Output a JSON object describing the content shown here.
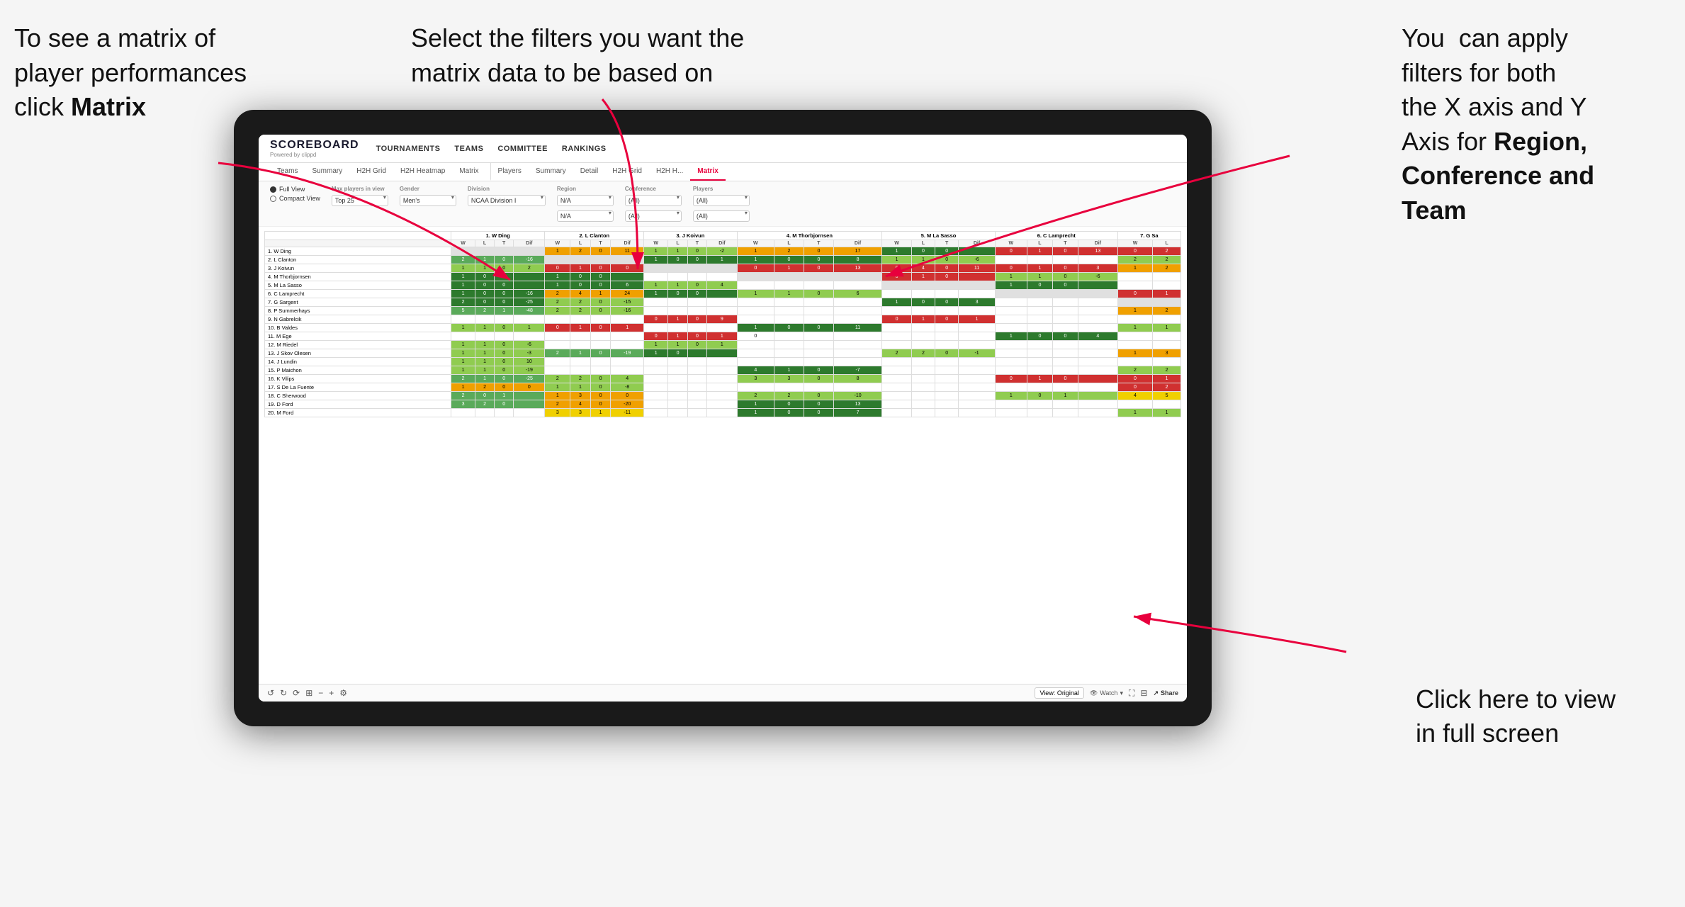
{
  "annotations": {
    "topleft": {
      "line1": "To see a matrix of",
      "line2": "player performances",
      "line3_prefix": "click ",
      "line3_bold": "Matrix"
    },
    "topmid": {
      "text": "Select the filters you want the matrix data to be based on"
    },
    "topright": {
      "line1": "You  can apply",
      "line2": "filters for both",
      "line3": "the X axis and Y",
      "line4_prefix": "Axis for ",
      "line4_bold": "Region,",
      "line5_bold": "Conference and",
      "line6_bold": "Team"
    },
    "bottomright": {
      "line1": "Click here to view",
      "line2": "in full screen"
    }
  },
  "app": {
    "logo_main": "SCOREBOARD",
    "logo_sub": "Powered by clippd",
    "nav": [
      "TOURNAMENTS",
      "TEAMS",
      "COMMITTEE",
      "RANKINGS"
    ],
    "tabs_row1": [
      "Teams",
      "Summary",
      "H2H Grid",
      "H2H Heatmap",
      "Matrix",
      "Players",
      "Summary",
      "Detail",
      "H2H Grid",
      "H2H H...",
      "Matrix"
    ],
    "active_tab": "Matrix",
    "filters": {
      "view_options": [
        "Full View",
        "Compact View"
      ],
      "selected_view": "Full View",
      "max_players_label": "Max players in view",
      "max_players_value": "Top 25",
      "gender_label": "Gender",
      "gender_value": "Men's",
      "division_label": "Division",
      "division_value": "NCAA Division I",
      "region_label": "Region",
      "region_value": "N/A",
      "conference_label": "Conference",
      "conference_value1": "(All)",
      "conference_value2": "(All)",
      "players_label": "Players",
      "players_value1": "(All)",
      "players_value2": "(All)"
    },
    "column_headers": [
      "1. W Ding",
      "2. L Clanton",
      "3. J Koivun",
      "4. M Thorbjornsen",
      "5. M La Sasso",
      "6. C Lamprecht",
      "7. G Sa"
    ],
    "sub_headers": [
      "W",
      "L",
      "T",
      "Dif"
    ],
    "rows": [
      {
        "name": "1. W Ding",
        "cells": [
          [
            null,
            null,
            null,
            null
          ],
          [
            1,
            2,
            0,
            11
          ],
          [
            1,
            1,
            0,
            -2
          ],
          [
            1,
            2,
            0,
            17
          ],
          [
            1,
            0,
            0,
            null
          ],
          [
            0,
            1,
            0,
            13
          ],
          [
            0,
            2
          ]
        ]
      },
      {
        "name": "2. L Clanton",
        "cells": [
          [
            2,
            1,
            0,
            -16
          ],
          [
            null,
            null,
            null,
            null
          ],
          [
            1,
            0,
            0,
            1
          ],
          [
            1,
            0,
            0,
            8
          ],
          [
            1,
            1,
            0,
            -6
          ],
          [
            null,
            null,
            null,
            null
          ],
          [
            2,
            2
          ]
        ]
      },
      {
        "name": "3. J Koivun",
        "cells": [
          [
            1,
            1,
            0,
            2
          ],
          [
            0,
            1,
            0,
            0
          ],
          [
            null,
            null,
            null,
            null
          ],
          [
            0,
            1,
            0,
            13
          ],
          [
            0,
            4,
            0,
            11
          ],
          [
            0,
            1,
            0,
            3
          ],
          [
            1,
            2
          ]
        ]
      },
      {
        "name": "4. M Thorbjornsen",
        "cells": [
          [
            1,
            0,
            0,
            null
          ],
          [
            1,
            0,
            0,
            null
          ],
          [
            null,
            null,
            null,
            null
          ],
          [
            null,
            null,
            null,
            null
          ],
          [
            0,
            1,
            0,
            null
          ],
          [
            1,
            1,
            0,
            -6
          ],
          [
            null
          ]
        ]
      },
      {
        "name": "5. M La Sasso",
        "cells": [
          [
            1,
            0,
            0,
            null
          ],
          [
            1,
            0,
            0,
            6
          ],
          [
            1,
            1,
            0,
            4
          ],
          [
            null,
            null,
            null,
            null
          ],
          [
            null,
            null,
            null,
            null
          ],
          [
            1,
            0,
            0,
            null
          ],
          [
            null
          ]
        ]
      },
      {
        "name": "6. C Lamprecht",
        "cells": [
          [
            1,
            0,
            0,
            -16
          ],
          [
            2,
            4,
            1,
            24
          ],
          [
            1,
            0,
            0,
            null
          ],
          [
            1,
            1,
            0,
            6
          ],
          [
            null,
            null,
            null,
            null
          ],
          [
            null,
            null,
            null,
            null
          ],
          [
            0,
            1
          ]
        ]
      },
      {
        "name": "7. G Sargent",
        "cells": [
          [
            2,
            0,
            0,
            -25
          ],
          [
            2,
            2,
            0,
            -15
          ],
          [
            null,
            null,
            null,
            null
          ],
          [
            null,
            null,
            null,
            null
          ],
          [
            1,
            0,
            0,
            3
          ],
          [
            null,
            null,
            null,
            null
          ],
          [
            null
          ]
        ]
      },
      {
        "name": "8. P Summerhays",
        "cells": [
          [
            5,
            2,
            1,
            -48
          ],
          [
            2,
            2,
            0,
            -16
          ],
          [
            null,
            null,
            null,
            null
          ],
          [
            null,
            null,
            null,
            null
          ],
          [
            null,
            null,
            null,
            null
          ],
          [
            null,
            null,
            null,
            null
          ],
          [
            1,
            2
          ]
        ]
      },
      {
        "name": "9. N Gabrelcik",
        "cells": [
          [
            null,
            null,
            null,
            null
          ],
          [
            null,
            null,
            null,
            null
          ],
          [
            0,
            1,
            0,
            9
          ],
          [
            null,
            null,
            null,
            null
          ],
          [
            0,
            1,
            0,
            1
          ],
          [
            null,
            null,
            null,
            null
          ],
          [
            null
          ]
        ]
      },
      {
        "name": "10. B Valdes",
        "cells": [
          [
            1,
            1,
            0,
            1
          ],
          [
            0,
            1,
            0,
            1
          ],
          [
            null,
            null,
            null,
            null
          ],
          [
            1,
            0,
            0,
            11
          ],
          [
            null,
            null,
            null,
            null
          ],
          [
            null,
            null,
            null,
            null
          ],
          [
            1,
            1
          ]
        ]
      },
      {
        "name": "11. M Ege",
        "cells": [
          [
            null,
            null,
            null,
            null
          ],
          [
            null,
            null,
            null,
            null
          ],
          [
            0,
            1,
            0,
            1
          ],
          [
            0,
            null,
            null,
            null
          ],
          [
            null,
            null,
            null,
            null
          ],
          [
            1,
            0,
            0,
            4
          ],
          [
            null
          ]
        ]
      },
      {
        "name": "12. M Riedel",
        "cells": [
          [
            1,
            1,
            0,
            -6
          ],
          [
            null,
            null,
            null,
            null
          ],
          [
            1,
            1,
            0,
            1
          ],
          [
            null,
            null,
            null,
            null
          ],
          [
            null,
            null,
            null,
            null
          ],
          [
            null,
            null,
            null,
            null
          ],
          [
            null
          ]
        ]
      },
      {
        "name": "13. J Skov Olesen",
        "cells": [
          [
            1,
            1,
            0,
            -3
          ],
          [
            2,
            1,
            0,
            -19
          ],
          [
            1,
            0,
            null,
            null
          ],
          [
            null,
            null,
            null,
            null
          ],
          [
            2,
            2,
            0,
            -1
          ],
          [
            null,
            null,
            null,
            null
          ],
          [
            1,
            3
          ]
        ]
      },
      {
        "name": "14. J Lundin",
        "cells": [
          [
            1,
            1,
            0,
            10
          ],
          [
            null,
            null,
            null,
            null
          ],
          [
            null,
            null,
            null,
            null
          ],
          [
            null,
            null,
            null,
            null
          ],
          [
            null,
            null,
            null,
            null
          ],
          [
            null,
            null,
            null,
            null
          ],
          [
            null
          ]
        ]
      },
      {
        "name": "15. P Maichon",
        "cells": [
          [
            1,
            1,
            0,
            -19
          ],
          [
            null,
            null,
            null,
            null
          ],
          [
            null,
            null,
            null,
            null
          ],
          [
            4,
            1,
            0,
            -7
          ],
          [
            null,
            null,
            null,
            null
          ],
          [
            null,
            null,
            null,
            null
          ],
          [
            2,
            2
          ]
        ]
      },
      {
        "name": "16. K Vilips",
        "cells": [
          [
            2,
            1,
            0,
            -25
          ],
          [
            2,
            2,
            0,
            4
          ],
          [
            null,
            null,
            null,
            null
          ],
          [
            3,
            3,
            0,
            8
          ],
          [
            null,
            null,
            null,
            null
          ],
          [
            0,
            1,
            0,
            null
          ],
          [
            0,
            1
          ]
        ]
      },
      {
        "name": "17. S De La Fuente",
        "cells": [
          [
            1,
            2,
            0,
            0
          ],
          [
            1,
            1,
            0,
            -8
          ],
          [
            null,
            null,
            null,
            null
          ],
          [
            null,
            null,
            null,
            null
          ],
          [
            null,
            null,
            null,
            null
          ],
          [
            null,
            null,
            null,
            null
          ],
          [
            0,
            2
          ]
        ]
      },
      {
        "name": "18. C Sherwood",
        "cells": [
          [
            2,
            0,
            1,
            null
          ],
          [
            1,
            3,
            0,
            0
          ],
          [
            null,
            null,
            null,
            null
          ],
          [
            2,
            2,
            0,
            -10
          ],
          [
            null,
            null,
            null,
            null
          ],
          [
            1,
            0,
            1,
            null
          ],
          [
            4,
            5
          ]
        ]
      },
      {
        "name": "19. D Ford",
        "cells": [
          [
            3,
            2,
            0,
            null
          ],
          [
            2,
            4,
            0,
            -20
          ],
          [
            null,
            null,
            null,
            null
          ],
          [
            1,
            0,
            0,
            13
          ],
          [
            null,
            null,
            null,
            null
          ],
          [
            null,
            null,
            null,
            null
          ],
          [
            null
          ]
        ]
      },
      {
        "name": "20. M Ford",
        "cells": [
          [
            null,
            null,
            null,
            null
          ],
          [
            3,
            3,
            1,
            -11
          ],
          [
            null,
            null,
            null,
            null
          ],
          [
            1,
            0,
            0,
            7
          ],
          [
            null,
            null,
            null,
            null
          ],
          [
            null,
            null,
            null,
            null
          ],
          [
            1,
            1
          ]
        ]
      }
    ],
    "toolbar": {
      "view_btn": "View: Original",
      "watch_btn": "Watch",
      "share_btn": "Share"
    }
  }
}
